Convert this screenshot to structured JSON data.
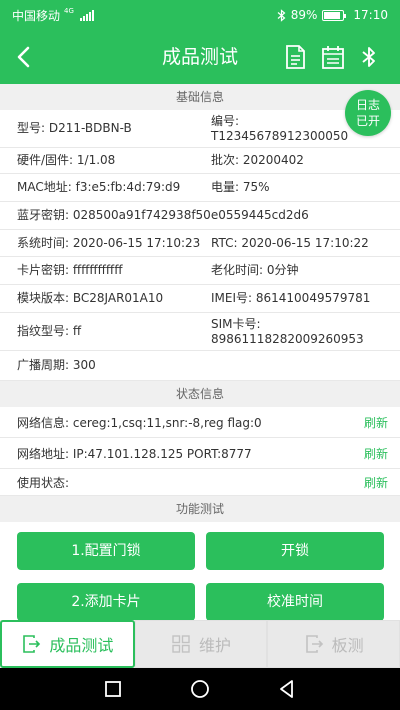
{
  "status_bar": {
    "carrier": "中国移动",
    "network": "4G",
    "battery": "89%",
    "battery_level": 0.89,
    "time": "17:10"
  },
  "header": {
    "title": "成品测试",
    "back_icon": "back-arrow-icon",
    "icons": [
      "document-icon",
      "calendar-icon",
      "bluetooth-icon"
    ]
  },
  "log_badge": {
    "line1": "日志",
    "line2": "已开"
  },
  "basic_info": {
    "title": "基础信息",
    "model": "型号: D211-BDBN-B",
    "serial_label": "编号:",
    "serial_value": "T12345678912300050",
    "hw_fw": "硬件/固件: 1/1.08",
    "batch": "批次: 20200402",
    "mac": "MAC地址: f3:e5:fb:4d:79:d9",
    "power": "电量: 75%",
    "bt_key": "蓝牙密钥: 028500a91f742938f50e0559445cd2d6",
    "system_time": "系统时间: 2020-06-15 17:10:23",
    "rtc": "RTC: 2020-06-15 17:10:22",
    "card_key": "卡片密钥: ffffffffffff",
    "aging_time": "老化时间: 0分钟",
    "module_version": "模块版本: BC28JAR01A10",
    "imei": "IMEI号: 861410049579781",
    "fingerprint_model": "指纹型号: ff",
    "sim_label": "SIM卡号:",
    "sim_value": "89861118282009260953",
    "broadcast_period": "广播周期: 300"
  },
  "status_info": {
    "title": "状态信息",
    "rows": [
      {
        "text": "网络信息: cereg:1,csq:11,snr:-8,reg flag:0",
        "action": "刷新"
      },
      {
        "text": "网络地址: IP:47.101.128.125 PORT:8777",
        "action": "刷新"
      },
      {
        "text": "使用状态:",
        "action": "刷新"
      }
    ]
  },
  "function_test": {
    "title": "功能测试",
    "buttons": [
      "1.配置门锁",
      "开锁",
      "2.添加卡片",
      "校准时间"
    ]
  },
  "tabbar": {
    "tabs": [
      {
        "label": "成品测试",
        "icon": "export-icon",
        "active": true
      },
      {
        "label": "维护",
        "icon": "grid-icon",
        "active": false
      },
      {
        "label": "板测",
        "icon": "export-icon",
        "active": false
      }
    ]
  },
  "system_nav": {
    "icons": [
      "recent-apps-icon",
      "home-icon",
      "back-triangle-icon"
    ]
  },
  "colors": {
    "accent": "#2bbf5c",
    "section_bg": "#f0f0f0",
    "tab_bg": "#e9e9e9"
  }
}
